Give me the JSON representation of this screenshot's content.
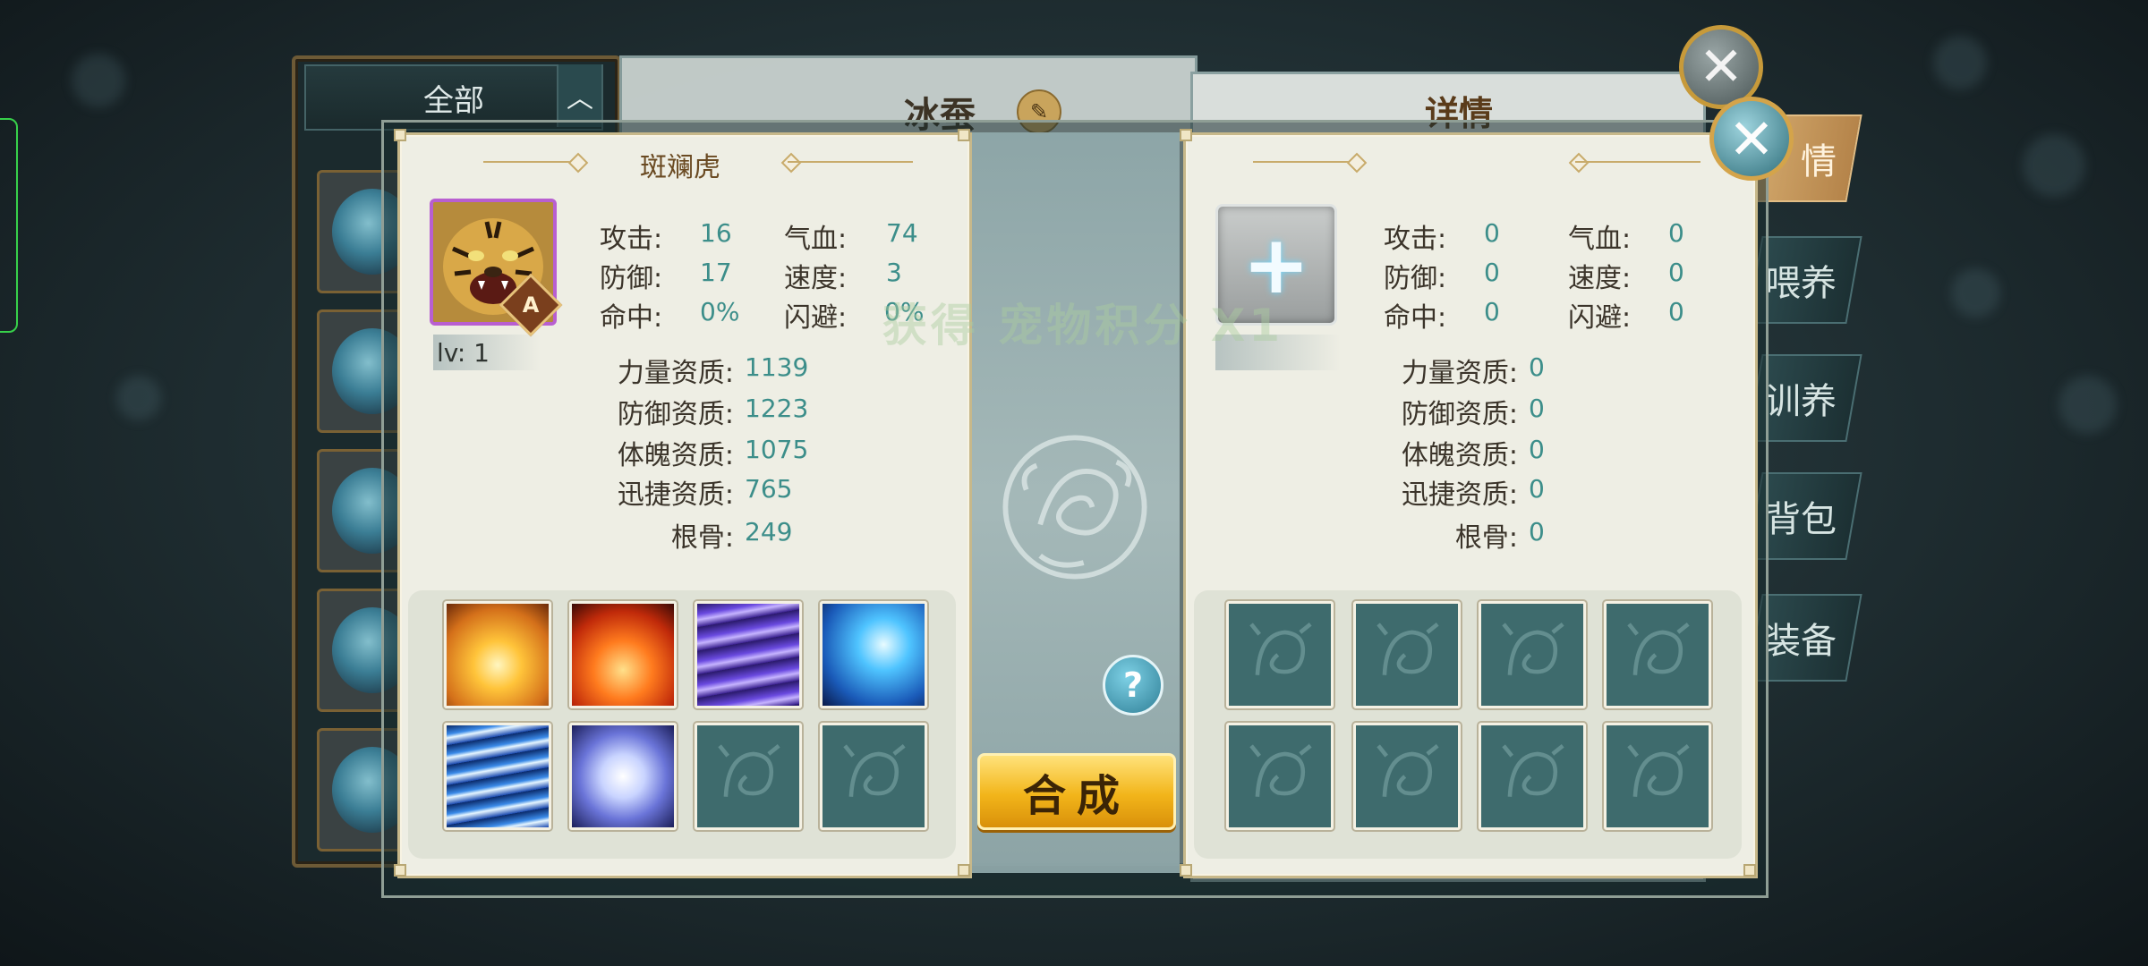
{
  "background": {
    "list_header": "全部",
    "list_chevron": "︿",
    "detail_title": "冰蚕",
    "detail_tab_title": "详情"
  },
  "side_tabs": [
    {
      "label": "情",
      "active": true
    },
    {
      "label": "喂养",
      "active": false
    },
    {
      "label": "训养",
      "active": false
    },
    {
      "label": "背包",
      "active": false
    },
    {
      "label": "装备",
      "active": false
    }
  ],
  "left_pet": {
    "name": "斑斓虎",
    "level": "lv: 1",
    "grade": "A",
    "stats": {
      "attack_label": "攻击:",
      "attack": "16",
      "hp_label": "气血:",
      "hp": "74",
      "defense_label": "防御:",
      "defense": "17",
      "speed_label": "速度:",
      "speed": "3",
      "hit_label": "命中:",
      "hit": "0%",
      "dodge_label": "闪避:",
      "dodge": "0%"
    },
    "aptitudes": {
      "str_label": "力量资质:",
      "str": "1139",
      "def_label": "防御资质:",
      "def": "1223",
      "con_label": "体魄资质:",
      "con": "1075",
      "agi_label": "迅捷资质:",
      "agi": "765",
      "root_label": "根骨:",
      "root": "249"
    },
    "skills": [
      "golden-burst-icon",
      "fire-burst-icon",
      "purple-vortex-icon",
      "blue-shard-icon",
      "wind-streak-icon",
      "silver-orb-icon",
      "empty",
      "empty"
    ]
  },
  "right_pet": {
    "add_symbol": "+",
    "stats": {
      "attack_label": "攻击:",
      "attack": "0",
      "hp_label": "气血:",
      "hp": "0",
      "defense_label": "防御:",
      "defense": "0",
      "speed_label": "速度:",
      "speed": "0",
      "hit_label": "命中:",
      "hit": "0",
      "dodge_label": "闪避:",
      "dodge": "0"
    },
    "aptitudes": {
      "str_label": "力量资质:",
      "str": "0",
      "def_label": "防御资质:",
      "def": "0",
      "con_label": "体魄资质:",
      "con": "0",
      "agi_label": "迅捷资质:",
      "agi": "0",
      "root_label": "根骨:",
      "root": "0"
    }
  },
  "center": {
    "help_symbol": "?",
    "compose_label": "合成",
    "floating_text": "获得 宠物积分 X1"
  },
  "close_symbol": "✕",
  "colors": {
    "value_teal": "#3c8e8a",
    "panel_bg": "#eeeee4",
    "compose_gold": "#f2b51a",
    "frame_gold": "#c8ab6b"
  }
}
